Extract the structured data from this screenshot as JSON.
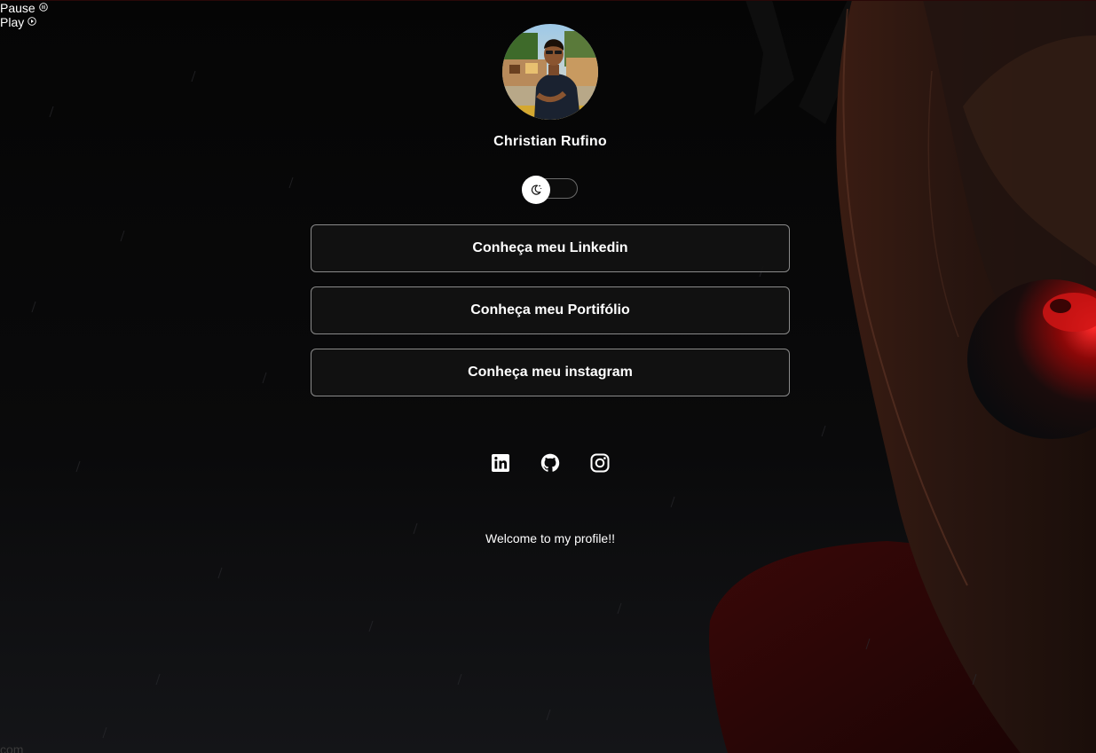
{
  "media": {
    "pause_label": "Pause",
    "play_label": "Play",
    "pause_icon": "pause-circle-icon",
    "play_icon": "play-circle-icon"
  },
  "profile": {
    "name": "Christian Rufino",
    "avatar_icon": "profile-photo"
  },
  "theme_toggle": {
    "icon": "moon-icon",
    "state": "dark"
  },
  "links": [
    {
      "label": "Conheça meu Linkedin"
    },
    {
      "label": "Conheça meu Portifólio"
    },
    {
      "label": "Conheça meu instagram"
    }
  ],
  "socials": [
    {
      "icon": "linkedin-icon"
    },
    {
      "icon": "github-icon"
    },
    {
      "icon": "instagram-icon"
    }
  ],
  "welcome_text": "Welcome to my profile!!",
  "footer_fragment": "com",
  "colors": {
    "background": "#060606",
    "accent_red": "#e01818",
    "button_border": "#8a8a8a",
    "text": "#ffffff"
  }
}
